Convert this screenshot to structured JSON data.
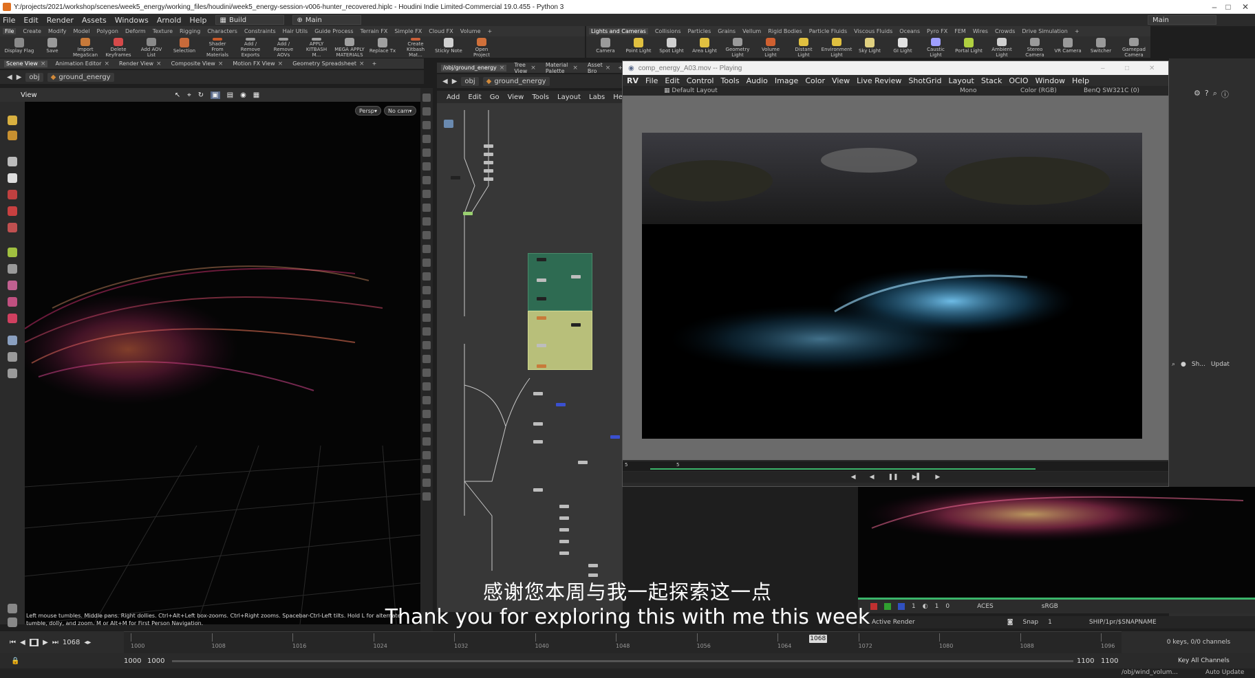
{
  "window": {
    "title": "Y:/projects/2021/workshop/scenes/week5_energy/working_files/houdini/week5_energy-session-v006-hunter_recovered.hiplc - Houdini Indie Limited-Commercial 19.0.455 - Python 3",
    "right_desktop": "Main",
    "min": "–",
    "max": "□",
    "close": "✕"
  },
  "menubar": {
    "items": [
      "File",
      "Edit",
      "Render",
      "Assets",
      "Windows",
      "Arnold",
      "Help"
    ],
    "desktop_build": "Build",
    "desktop_main": "Main"
  },
  "shelf_tabs_left": [
    "File",
    "Create",
    "Modify",
    "Model",
    "Polygon",
    "Deform",
    "Texture",
    "Rigging",
    "Characters",
    "Constraints",
    "Hair Utils",
    "Guide Process",
    "Terrain FX",
    "Simple FX",
    "Cloud FX",
    "Volume"
  ],
  "shelf_tabs_right": [
    "Lights and Cameras",
    "Collisions",
    "Particles",
    "Grains",
    "Vellum",
    "Rigid Bodies",
    "Particle Fluids",
    "Viscous Fluids",
    "Oceans",
    "Pyro FX",
    "FEM",
    "Wires",
    "Crowds",
    "Drive Simulation"
  ],
  "shelf_tools_left": [
    {
      "label": "Display Flag",
      "color": "#8a8a8a"
    },
    {
      "label": "Save",
      "color": "#9a9a9a"
    },
    {
      "label": "Import MegaScan",
      "color": "#c87a3a"
    },
    {
      "label": "Delete Keyframes",
      "color": "#d64a4a"
    },
    {
      "label": "Add AOV List",
      "color": "#8a8a8a"
    },
    {
      "label": "Selection",
      "color": "#c86a3a"
    },
    {
      "label": "Shader From Materials",
      "color": "#c85a2a"
    },
    {
      "label": "Add / Remove Exports",
      "color": "#9a9a9a"
    },
    {
      "label": "Add / Remove AOVs",
      "color": "#9a9a9a"
    },
    {
      "label": "APPLY KITBASH M...",
      "color": "#a0a0a0"
    },
    {
      "label": "MEGA APPLY MATERIALS",
      "color": "#a0a0a0"
    },
    {
      "label": "Replace Tx",
      "color": "#a0a0a0"
    },
    {
      "label": "Create Kitbash Mat...",
      "color": "#c8603a"
    },
    {
      "label": "Sticky Note",
      "color": "#d0d0d0"
    },
    {
      "label": "Open Project",
      "color": "#d0703a"
    }
  ],
  "shelf_tools_right": [
    {
      "label": "Camera",
      "color": "#9a9a9a"
    },
    {
      "label": "Point Light",
      "color": "#e0c040"
    },
    {
      "label": "Spot Light",
      "color": "#d0d0d0"
    },
    {
      "label": "Area Light",
      "color": "#e0c040"
    },
    {
      "label": "Geometry Light",
      "color": "#9a9a9a"
    },
    {
      "label": "Volume Light",
      "color": "#d06030"
    },
    {
      "label": "Distant Light",
      "color": "#e0c040"
    },
    {
      "label": "Environment Light",
      "color": "#e0c040"
    },
    {
      "label": "Sky Light",
      "color": "#e0d080"
    },
    {
      "label": "GI Light",
      "color": "#e0e0e0"
    },
    {
      "label": "Caustic Light",
      "color": "#a0a0ff"
    },
    {
      "label": "Portal Light",
      "color": "#b0d040"
    },
    {
      "label": "Ambient Light",
      "color": "#d0d0d0"
    },
    {
      "label": "Stereo Camera",
      "color": "#9a9a9a"
    },
    {
      "label": "VR Camera",
      "color": "#9a9a9a"
    },
    {
      "label": "Switcher",
      "color": "#9a9a9a"
    },
    {
      "label": "Gamepad Camera",
      "color": "#9a9a9a"
    }
  ],
  "pane_tabs_left": [
    "Scene View",
    "Animation Editor",
    "Render View",
    "Composite View",
    "Motion FX View",
    "Geometry Spreadsheet"
  ],
  "pane_tabs_net": [
    "/obj/ground_energy",
    "Tree View",
    "Material Palette",
    "Asset Bro"
  ],
  "path": {
    "root": "obj",
    "node": "ground_energy"
  },
  "viewer": {
    "label": "View",
    "persp": "Persp",
    "cam": "No cam"
  },
  "net_menu": [
    "Add",
    "Edit",
    "Go",
    "View",
    "Tools",
    "Layout",
    "Labs",
    "Help"
  ],
  "rv": {
    "title": "comp_energy_A03.mov -- Playing",
    "logo": "RV",
    "menu": [
      "File",
      "Edit",
      "Control",
      "Tools",
      "Audio",
      "Image",
      "Color",
      "View",
      "Live Review",
      "ShotGrid",
      "Layout",
      "Stack",
      "OCIO",
      "Window",
      "Help"
    ],
    "layout": "Default Layout",
    "mono": "Mono",
    "color": "Color (RGB)",
    "display": "BenQ SW321C (0)",
    "start_frame": "5",
    "current_frame": "5"
  },
  "right_panel": {
    "sh": "Sh...",
    "update": "Updat"
  },
  "render_bar": {
    "field1": "1",
    "field2": "1",
    "field3": "0",
    "aces": "ACES",
    "srgb": "sRGB"
  },
  "status_row": {
    "active_render": "Active Render",
    "snap": "Snap",
    "snap_value": "1",
    "path": "SHIP/1pr/$SNAPNAME"
  },
  "hint": "Left mouse tumbles. Middle pans. Right dollies. Ctrl+Alt+Left box-zooms. Ctrl+Right zooms. Spacebar-Ctrl-Left tilts. Hold L for alternate tumble, dolly, and zoom.    M or Alt+M for First Person Navigation.",
  "timeline": {
    "current_frame": "1068",
    "ticks": [
      "1000",
      "1008",
      "1016",
      "1024",
      "1032",
      "1040",
      "1048",
      "1056",
      "1064",
      "1072",
      "1080",
      "1088",
      "1096"
    ],
    "range_start": "1000",
    "range_start2": "1000",
    "range_end": "1100",
    "range_end2": "1100",
    "keys": "0 keys, 0/0 channels",
    "key_all": "Key All Channels",
    "bottom_path": "/obj/wind_volum...",
    "auto_update": "Auto Update"
  },
  "subtitles": {
    "zh": "感谢您本周与我一起探索这一点",
    "en": "Thank you for exploring this with me this week"
  },
  "colors": {
    "accent_green": "#3bb56a",
    "netbox_green": "#2e6b52",
    "netbox_yellow": "#b8bf7a"
  }
}
